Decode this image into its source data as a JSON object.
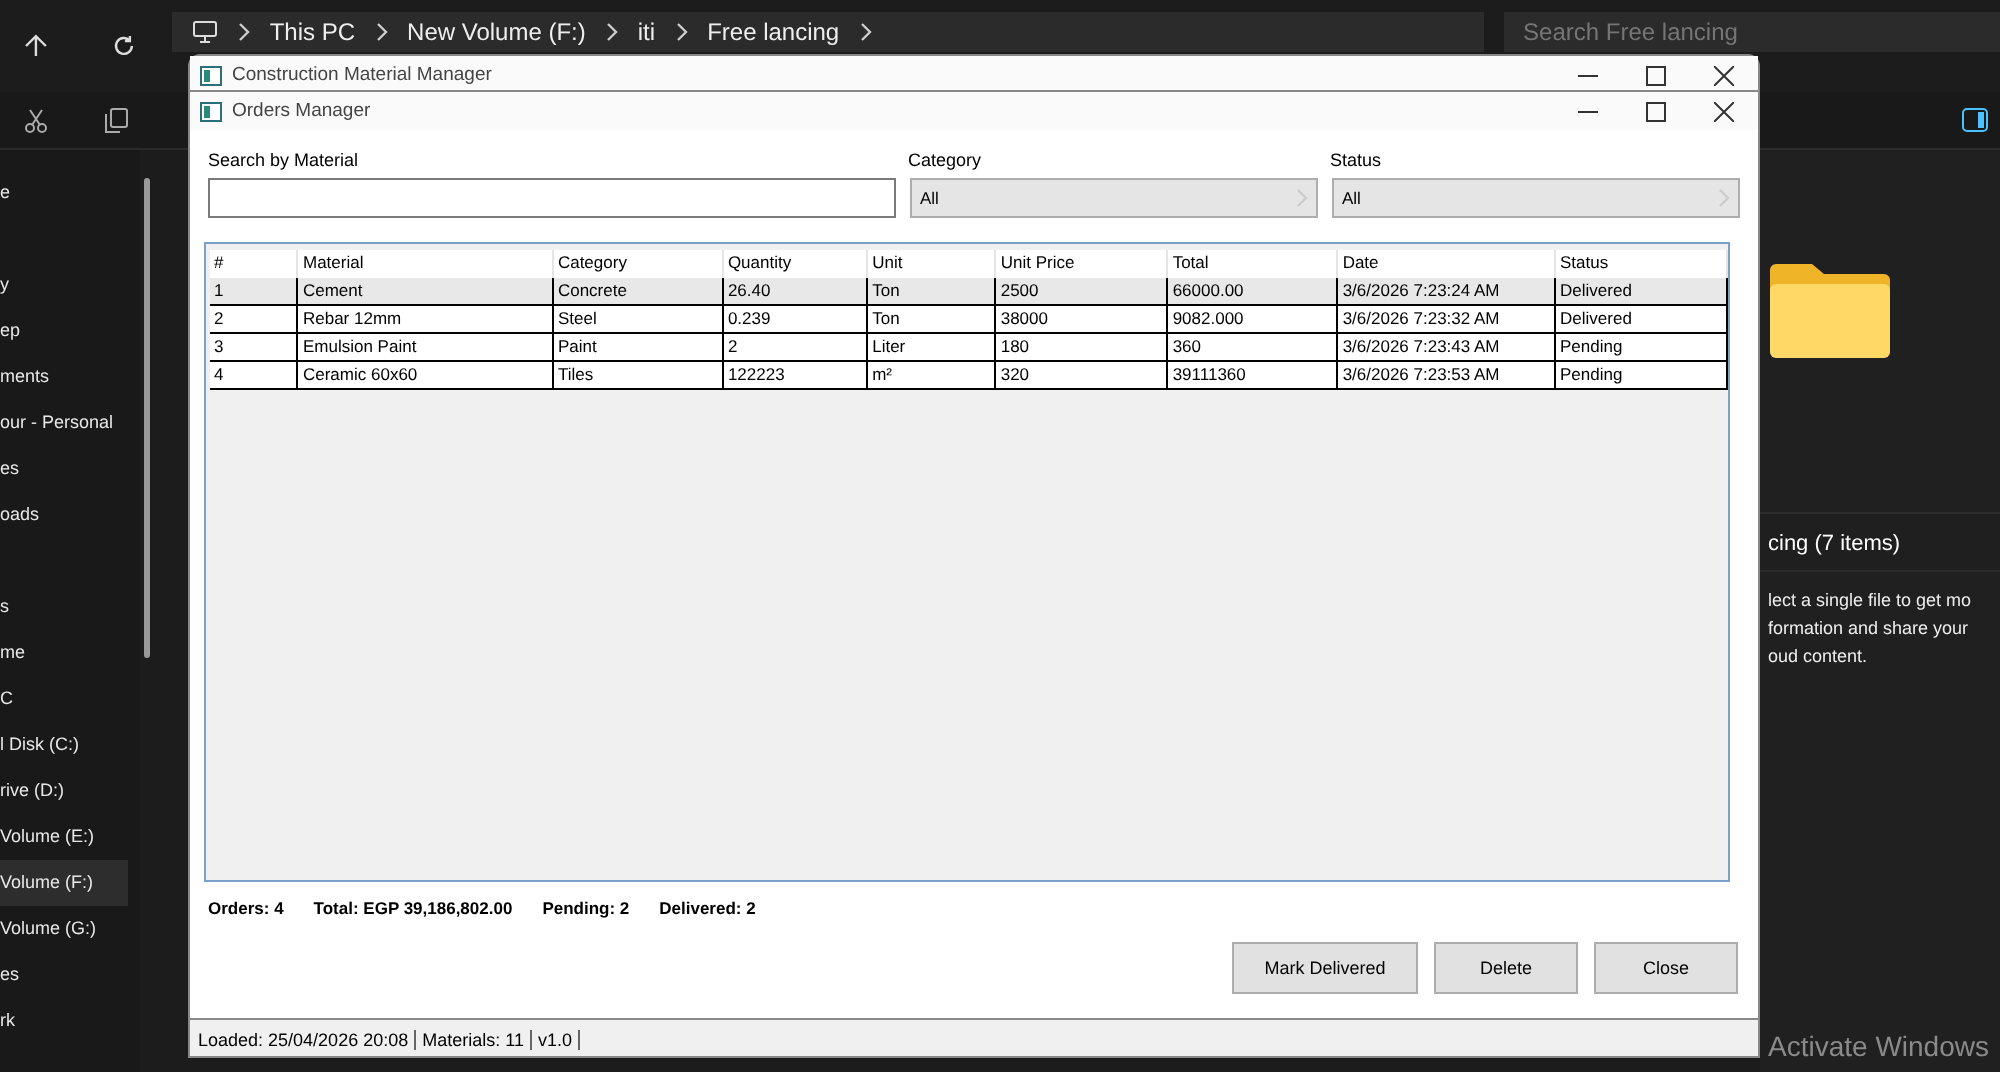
{
  "explorer": {
    "breadcrumb": [
      "This PC",
      "New Volume (F:)",
      "iti",
      "Free lancing"
    ],
    "search": {
      "placeholder": "Search Free lancing"
    },
    "sidebar": {
      "groups": [
        [
          {
            "label": "e",
            "selected": false
          }
        ],
        [
          {
            "label": "y",
            "selected": false
          },
          {
            "label": "ep",
            "selected": false
          },
          {
            "label": "ments",
            "selected": false
          },
          {
            "label": "our - Personal",
            "selected": false
          },
          {
            "label": "es",
            "selected": false
          },
          {
            "label": "oads",
            "selected": false
          }
        ],
        [
          {
            "label": "s",
            "selected": false
          },
          {
            "label": "me",
            "selected": false
          },
          {
            "label": "C",
            "selected": false
          },
          {
            "label": "l Disk (C:)",
            "selected": false
          },
          {
            "label": "rive (D:)",
            "selected": false
          },
          {
            "label": "Volume (E:)",
            "selected": false
          },
          {
            "label": "Volume (F:)",
            "selected": true
          },
          {
            "label": "Volume (G:)",
            "selected": false
          },
          {
            "label": "es",
            "selected": false
          },
          {
            "label": "rk",
            "selected": false
          }
        ]
      ]
    },
    "details": {
      "title": "cing (7 items)",
      "message": "lect a single file to get mo\nformation and share your\noud content."
    }
  },
  "back_window": {
    "title": "Construction Material Manager",
    "status_bar": [
      "Loaded: 25/04/2026 20:08",
      "Materials: 11",
      "v1.0"
    ]
  },
  "window": {
    "title": "Orders Manager",
    "filters": {
      "search": {
        "label": "Search by Material"
      },
      "category": {
        "label": "Category",
        "value": "All"
      },
      "status": {
        "label": "Status",
        "value": "All"
      }
    },
    "table": {
      "columns": [
        "#",
        "Material",
        "Category",
        "Quantity",
        "Unit",
        "Unit Price",
        "Total",
        "Date",
        "Status"
      ],
      "rows": [
        {
          "selected": true,
          "cells": [
            "1",
            "Cement",
            "Concrete",
            "26.40",
            "Ton",
            "2500",
            "66000.00",
            "3/6/2026 7:23:24 AM",
            "Delivered"
          ]
        },
        {
          "selected": false,
          "cells": [
            "2",
            "Rebar 12mm",
            "Steel",
            "0.239",
            "Ton",
            "38000",
            "9082.000",
            "3/6/2026 7:23:32 AM",
            "Delivered"
          ]
        },
        {
          "selected": false,
          "cells": [
            "3",
            "Emulsion Paint",
            "Paint",
            "2",
            "Liter",
            "180",
            "360",
            "3/6/2026 7:23:43 AM",
            "Pending"
          ]
        },
        {
          "selected": false,
          "cells": [
            "4",
            "Ceramic 60x60",
            "Tiles",
            "122223",
            "m²",
            "320",
            "39111360",
            "3/6/2026 7:23:53 AM",
            "Pending"
          ]
        }
      ]
    },
    "summary": [
      "Orders: 4",
      "Total: EGP 39,186,802.00",
      "Pending: 2",
      "Delivered: 2"
    ],
    "buttons": [
      "Mark Delivered",
      "Delete",
      "Close"
    ]
  },
  "overlay_text": "Activate Windows"
}
